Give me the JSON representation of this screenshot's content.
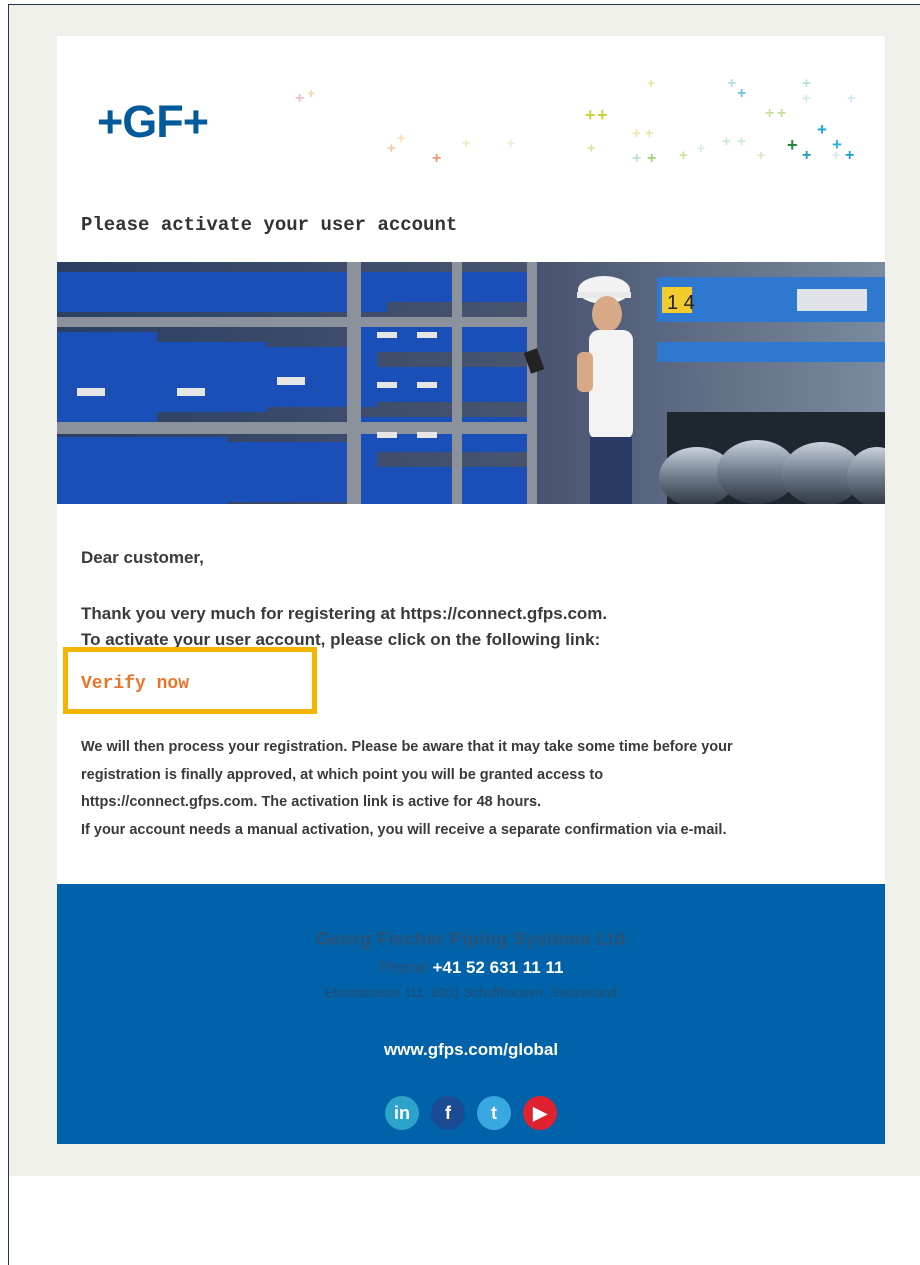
{
  "brand": {
    "logo_text": "+GF+",
    "color": "#005a9c"
  },
  "email": {
    "heading": "Please activate your user account",
    "greeting": "Dear customer,",
    "intro_line1": "Thank you very much for registering at https://connect.gfps.com.",
    "intro_line2": "To activate your user account, please click on the following link:",
    "verify_link": "Verify now",
    "body_line1": "We will then process your registration. Please be aware that it may take some time before your",
    "body_line2": "registration is finally approved, at which point you will be granted access to",
    "body_line3": "https://connect.gfps.com. The activation link is active for 48 hours.",
    "body_line4": "If your account needs a manual activation, you will receive a separate confirmation via e-mail."
  },
  "footer": {
    "company": "Georg Fischer Piping Systems Ltd",
    "phone_label": "Phone",
    "phone": "+41 52 631 11 11",
    "address": "Ebnatstrasse 111, 8201 Schaffhausen, Switzerland",
    "website": "www.gfps.com/global",
    "socials": [
      {
        "name": "linkedin",
        "glyph": "in"
      },
      {
        "name": "facebook",
        "glyph": "f"
      },
      {
        "name": "twitter",
        "glyph": "t"
      },
      {
        "name": "youtube",
        "glyph": "▶"
      }
    ]
  },
  "colors": {
    "accent_orange": "#e8752a",
    "highlight_box": "#f5b400",
    "footer_blue": "#0062a8"
  }
}
